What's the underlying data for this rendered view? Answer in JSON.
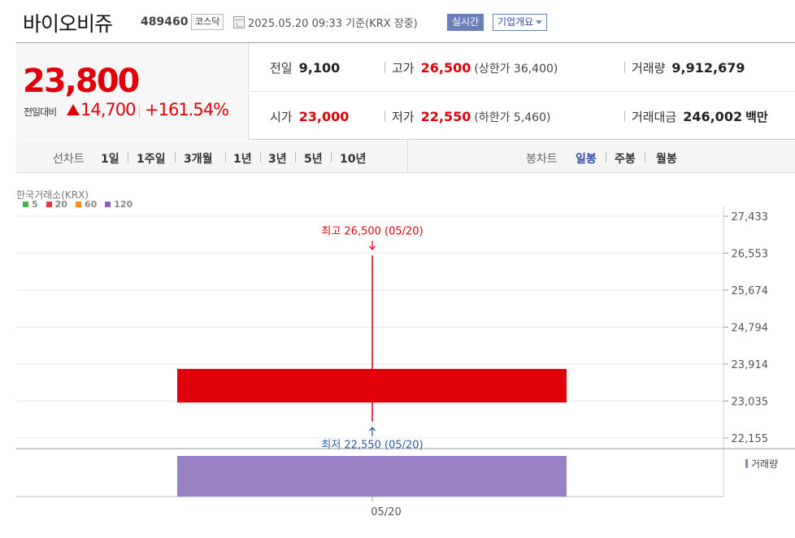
{
  "header": {
    "name": "바이오비쥬",
    "code": "489460",
    "market": "코스닥",
    "datetime": "2025.05.20 09:33",
    "basis": "기준(KRX 장중)",
    "realtime": "실시간",
    "company_overview": "기업개요"
  },
  "quote": {
    "price": "23,800",
    "diff_label": "전일대비",
    "diff_value": "14,700",
    "diff_rate": "+161.54%",
    "prev_label": "전일",
    "prev_value": "9,100",
    "high_label": "고가",
    "high_value": "26,500",
    "upper_limit": "(상한가 36,400)",
    "volume_label": "거래량",
    "volume_value": "9,912,679",
    "open_label": "시가",
    "open_value": "23,000",
    "low_label": "저가",
    "low_value": "22,550",
    "lower_limit": "(하한가 5,460)",
    "amount_label": "거래대금",
    "amount_value": "246,002",
    "amount_unit": "백만"
  },
  "periods": {
    "line_label": "선차트",
    "line_items": [
      "1일",
      "1주일",
      "3개월",
      "1년",
      "3년",
      "5년",
      "10년"
    ],
    "candle_label": "봉차트",
    "candle_items": [
      "일봉",
      "주봉",
      "월봉"
    ],
    "candle_active": 0
  },
  "colors": {
    "up": "#e0000b",
    "down_annotation": "#2c5ea8",
    "volume": "#9880c3",
    "ma5": "#4caf50",
    "ma20": "#e53935",
    "ma60": "#ff8a1f",
    "ma120": "#8e5bc8"
  },
  "chart_data": {
    "type": "candlestick",
    "source": "한국거래소(KRX)",
    "legend": [
      "5",
      "20",
      "60",
      "120"
    ],
    "y_ticks": [
      22155,
      23035,
      23914,
      24794,
      25674,
      26553,
      27433
    ],
    "ylim": [
      22155,
      27433
    ],
    "x_tick_labels": [
      "05/20"
    ],
    "candles": [
      {
        "date": "05/20",
        "open": 23000,
        "high": 26500,
        "low": 22550,
        "close": 23800
      }
    ],
    "annotations": {
      "high": "최고 26,500 (05/20)",
      "low": "최저 22,550 (05/20)"
    },
    "volume": {
      "label": "거래량",
      "values": [
        9912679
      ]
    }
  }
}
